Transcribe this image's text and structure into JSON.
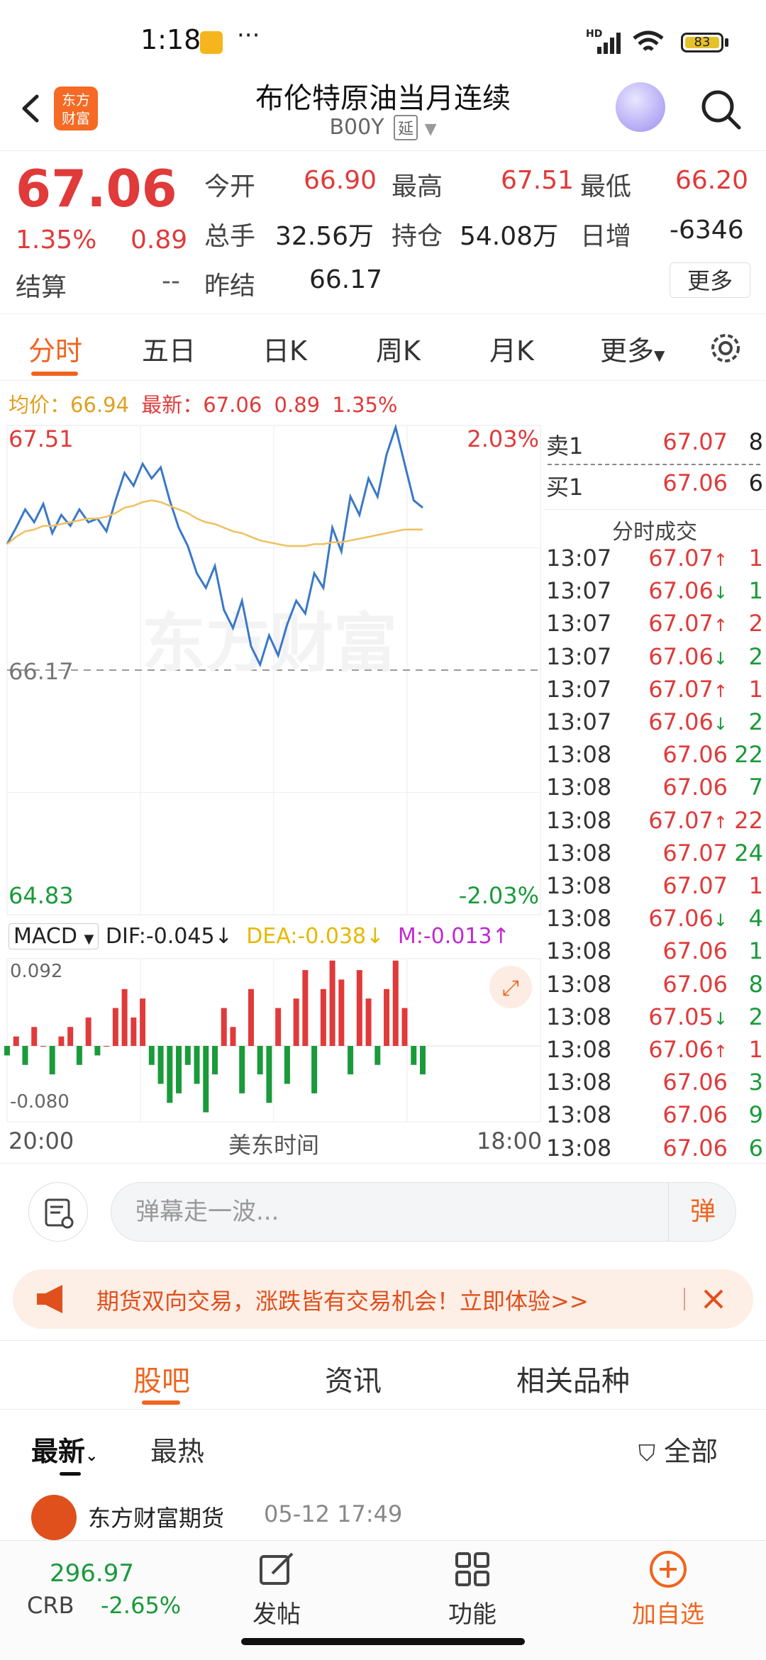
{
  "status_bar": {
    "time": "1:18",
    "battery": "83",
    "network": "HD"
  },
  "header": {
    "title": "布伦特原油当月连续",
    "code": "B00Y",
    "delay_badge": "延",
    "logo_line1": "东方",
    "logo_line2": "财富"
  },
  "quote": {
    "last": "67.06",
    "pct": "1.35%",
    "change": "0.89",
    "open_label": "今开",
    "open": "66.90",
    "high_label": "最高",
    "high": "67.51",
    "low_label": "最低",
    "low": "66.20",
    "volume_label": "总手",
    "volume": "32.56万",
    "oi_label": "持仓",
    "oi": "54.08万",
    "daily_inc_label": "日增",
    "daily_inc": "-6346",
    "settle_label": "结算",
    "settle": "--",
    "prev_settle_label": "昨结",
    "prev_settle": "66.17",
    "more_label": "更多"
  },
  "chart_tabs": [
    "分时",
    "五日",
    "日K",
    "周K",
    "月K",
    "更多"
  ],
  "info_line": {
    "avg_label": "均价：",
    "avg": "66.94",
    "latest_label": "最新：",
    "latest": "67.06",
    "change": "0.89",
    "pct": "1.35%"
  },
  "order_book": [
    {
      "label": "卖1",
      "price": "67.07",
      "vol": "8"
    },
    {
      "label": "买1",
      "price": "67.06",
      "vol": "6"
    }
  ],
  "trades_title": "分时成交",
  "trades": [
    {
      "time": "13:07",
      "price": "67.07",
      "arrow": "↑",
      "vol": "1",
      "vcolor": "red"
    },
    {
      "time": "13:07",
      "price": "67.06",
      "arrow": "↓",
      "vol": "1",
      "vcolor": "green"
    },
    {
      "time": "13:07",
      "price": "67.07",
      "arrow": "↑",
      "vol": "2",
      "vcolor": "red"
    },
    {
      "time": "13:07",
      "price": "67.06",
      "arrow": "↓",
      "vol": "2",
      "vcolor": "green"
    },
    {
      "time": "13:07",
      "price": "67.07",
      "arrow": "↑",
      "vol": "1",
      "vcolor": "red"
    },
    {
      "time": "13:07",
      "price": "67.06",
      "arrow": "↓",
      "vol": "2",
      "vcolor": "green"
    },
    {
      "time": "13:08",
      "price": "67.06",
      "arrow": "",
      "vol": "22",
      "vcolor": "green"
    },
    {
      "time": "13:08",
      "price": "67.06",
      "arrow": "",
      "vol": "7",
      "vcolor": "green"
    },
    {
      "time": "13:08",
      "price": "67.07",
      "arrow": "↑",
      "vol": "22",
      "vcolor": "red"
    },
    {
      "time": "13:08",
      "price": "67.07",
      "arrow": "",
      "vol": "24",
      "vcolor": "green"
    },
    {
      "time": "13:08",
      "price": "67.07",
      "arrow": "",
      "vol": "1",
      "vcolor": "red"
    },
    {
      "time": "13:08",
      "price": "67.06",
      "arrow": "↓",
      "vol": "4",
      "vcolor": "green"
    },
    {
      "time": "13:08",
      "price": "67.06",
      "arrow": "",
      "vol": "1",
      "vcolor": "green"
    },
    {
      "time": "13:08",
      "price": "67.06",
      "arrow": "",
      "vol": "8",
      "vcolor": "green"
    },
    {
      "time": "13:08",
      "price": "67.05",
      "arrow": "↓",
      "vol": "2",
      "vcolor": "green"
    },
    {
      "time": "13:08",
      "price": "67.06",
      "arrow": "↑",
      "vol": "1",
      "vcolor": "red"
    },
    {
      "time": "13:08",
      "price": "67.06",
      "arrow": "",
      "vol": "3",
      "vcolor": "green"
    },
    {
      "time": "13:08",
      "price": "67.06",
      "arrow": "",
      "vol": "9",
      "vcolor": "green"
    },
    {
      "time": "13:08",
      "price": "67.06",
      "arrow": "",
      "vol": "6",
      "vcolor": "green"
    }
  ],
  "chart_labels": {
    "y_top": "67.51",
    "y_top_pct": "2.03%",
    "y_mid": "66.17",
    "y_bottom": "64.83",
    "y_bottom_pct": "-2.03%",
    "macd_top": "0.092",
    "macd_bottom": "-0.080",
    "x_start": "20:00",
    "x_mid": "美东时间",
    "x_end": "18:00",
    "watermark": "东方财富"
  },
  "macd": {
    "selector": "MACD",
    "dif_label": "DIF:",
    "dif": "-0.045",
    "dea_label": "DEA:",
    "dea": "-0.038",
    "m_label": "M:",
    "m": "-0.013"
  },
  "chart_data": {
    "type": "line",
    "title": "",
    "xlabel": "美东时间",
    "ylabel": "",
    "ylim": [
      64.83,
      67.51
    ],
    "baseline": 66.17,
    "series": [
      {
        "name": "",
        "values": [
          66.86,
          66.95,
          67.05,
          66.98,
          67.08,
          66.92,
          67.02,
          66.96,
          67.05,
          66.98,
          67.0,
          66.93,
          67.1,
          67.25,
          67.18,
          67.3,
          67.22,
          67.28,
          67.1,
          66.95,
          66.85,
          66.7,
          66.62,
          66.74,
          66.5,
          66.4,
          66.55,
          66.3,
          66.2,
          66.36,
          66.25,
          66.42,
          66.55,
          66.48,
          66.7,
          66.62,
          66.95,
          66.82,
          67.12,
          67.02,
          67.22,
          67.12,
          67.35,
          67.5,
          67.3,
          67.1,
          67.06
        ]
      },
      {
        "name": "均价",
        "values": [
          66.86,
          66.9,
          66.93,
          66.94,
          66.96,
          66.96,
          66.97,
          66.98,
          66.99,
          67.0,
          67.0,
          67.01,
          67.03,
          67.06,
          67.07,
          67.09,
          67.1,
          67.09,
          67.07,
          67.05,
          67.03,
          67.0,
          66.98,
          66.97,
          66.95,
          66.93,
          66.92,
          66.9,
          66.88,
          66.87,
          66.86,
          66.85,
          66.85,
          66.85,
          66.86,
          66.86,
          66.87,
          66.87,
          66.88,
          66.89,
          66.9,
          66.91,
          66.92,
          66.93,
          66.94,
          66.94,
          66.94
        ]
      }
    ]
  },
  "macd_data": {
    "ylim": [
      -0.08,
      0.092
    ],
    "hist": [
      -0.01,
      0.01,
      -0.02,
      0.02,
      0.0,
      -0.03,
      0.01,
      0.02,
      -0.02,
      0.03,
      -0.01,
      0.0,
      0.04,
      0.06,
      0.03,
      0.05,
      -0.02,
      -0.04,
      -0.06,
      -0.05,
      -0.02,
      -0.04,
      -0.07,
      -0.03,
      0.04,
      0.02,
      -0.05,
      0.06,
      -0.03,
      -0.06,
      0.04,
      -0.04,
      0.05,
      0.08,
      -0.05,
      0.06,
      0.09,
      0.07,
      -0.03,
      0.08,
      0.05,
      -0.02,
      0.06,
      0.09,
      0.04,
      -0.02,
      -0.03
    ]
  },
  "comment": {
    "placeholder": "弹幕走一波...",
    "btn": "弹"
  },
  "promo": {
    "text": "期货双向交易，涨跌皆有交易机会！立即体验>>"
  },
  "community_tabs": [
    "股吧",
    "资讯",
    "相关品种"
  ],
  "sort_tabs": {
    "latest": "最新",
    "hot": "最热",
    "filter": "全部"
  },
  "post_preview": {
    "author": "东方财富期货",
    "date": "05-12 17:49"
  },
  "bottom_nav": {
    "index_value": "296.97",
    "index_name": "CRB",
    "index_pct": "-2.65%",
    "post": "发帖",
    "func": "功能",
    "add": "加自选"
  },
  "colors": {
    "accent": "#f0641e",
    "up": "#e03a3a",
    "down": "#1a9a3a",
    "line": "#3a78c8",
    "avg": "#f0c060"
  }
}
